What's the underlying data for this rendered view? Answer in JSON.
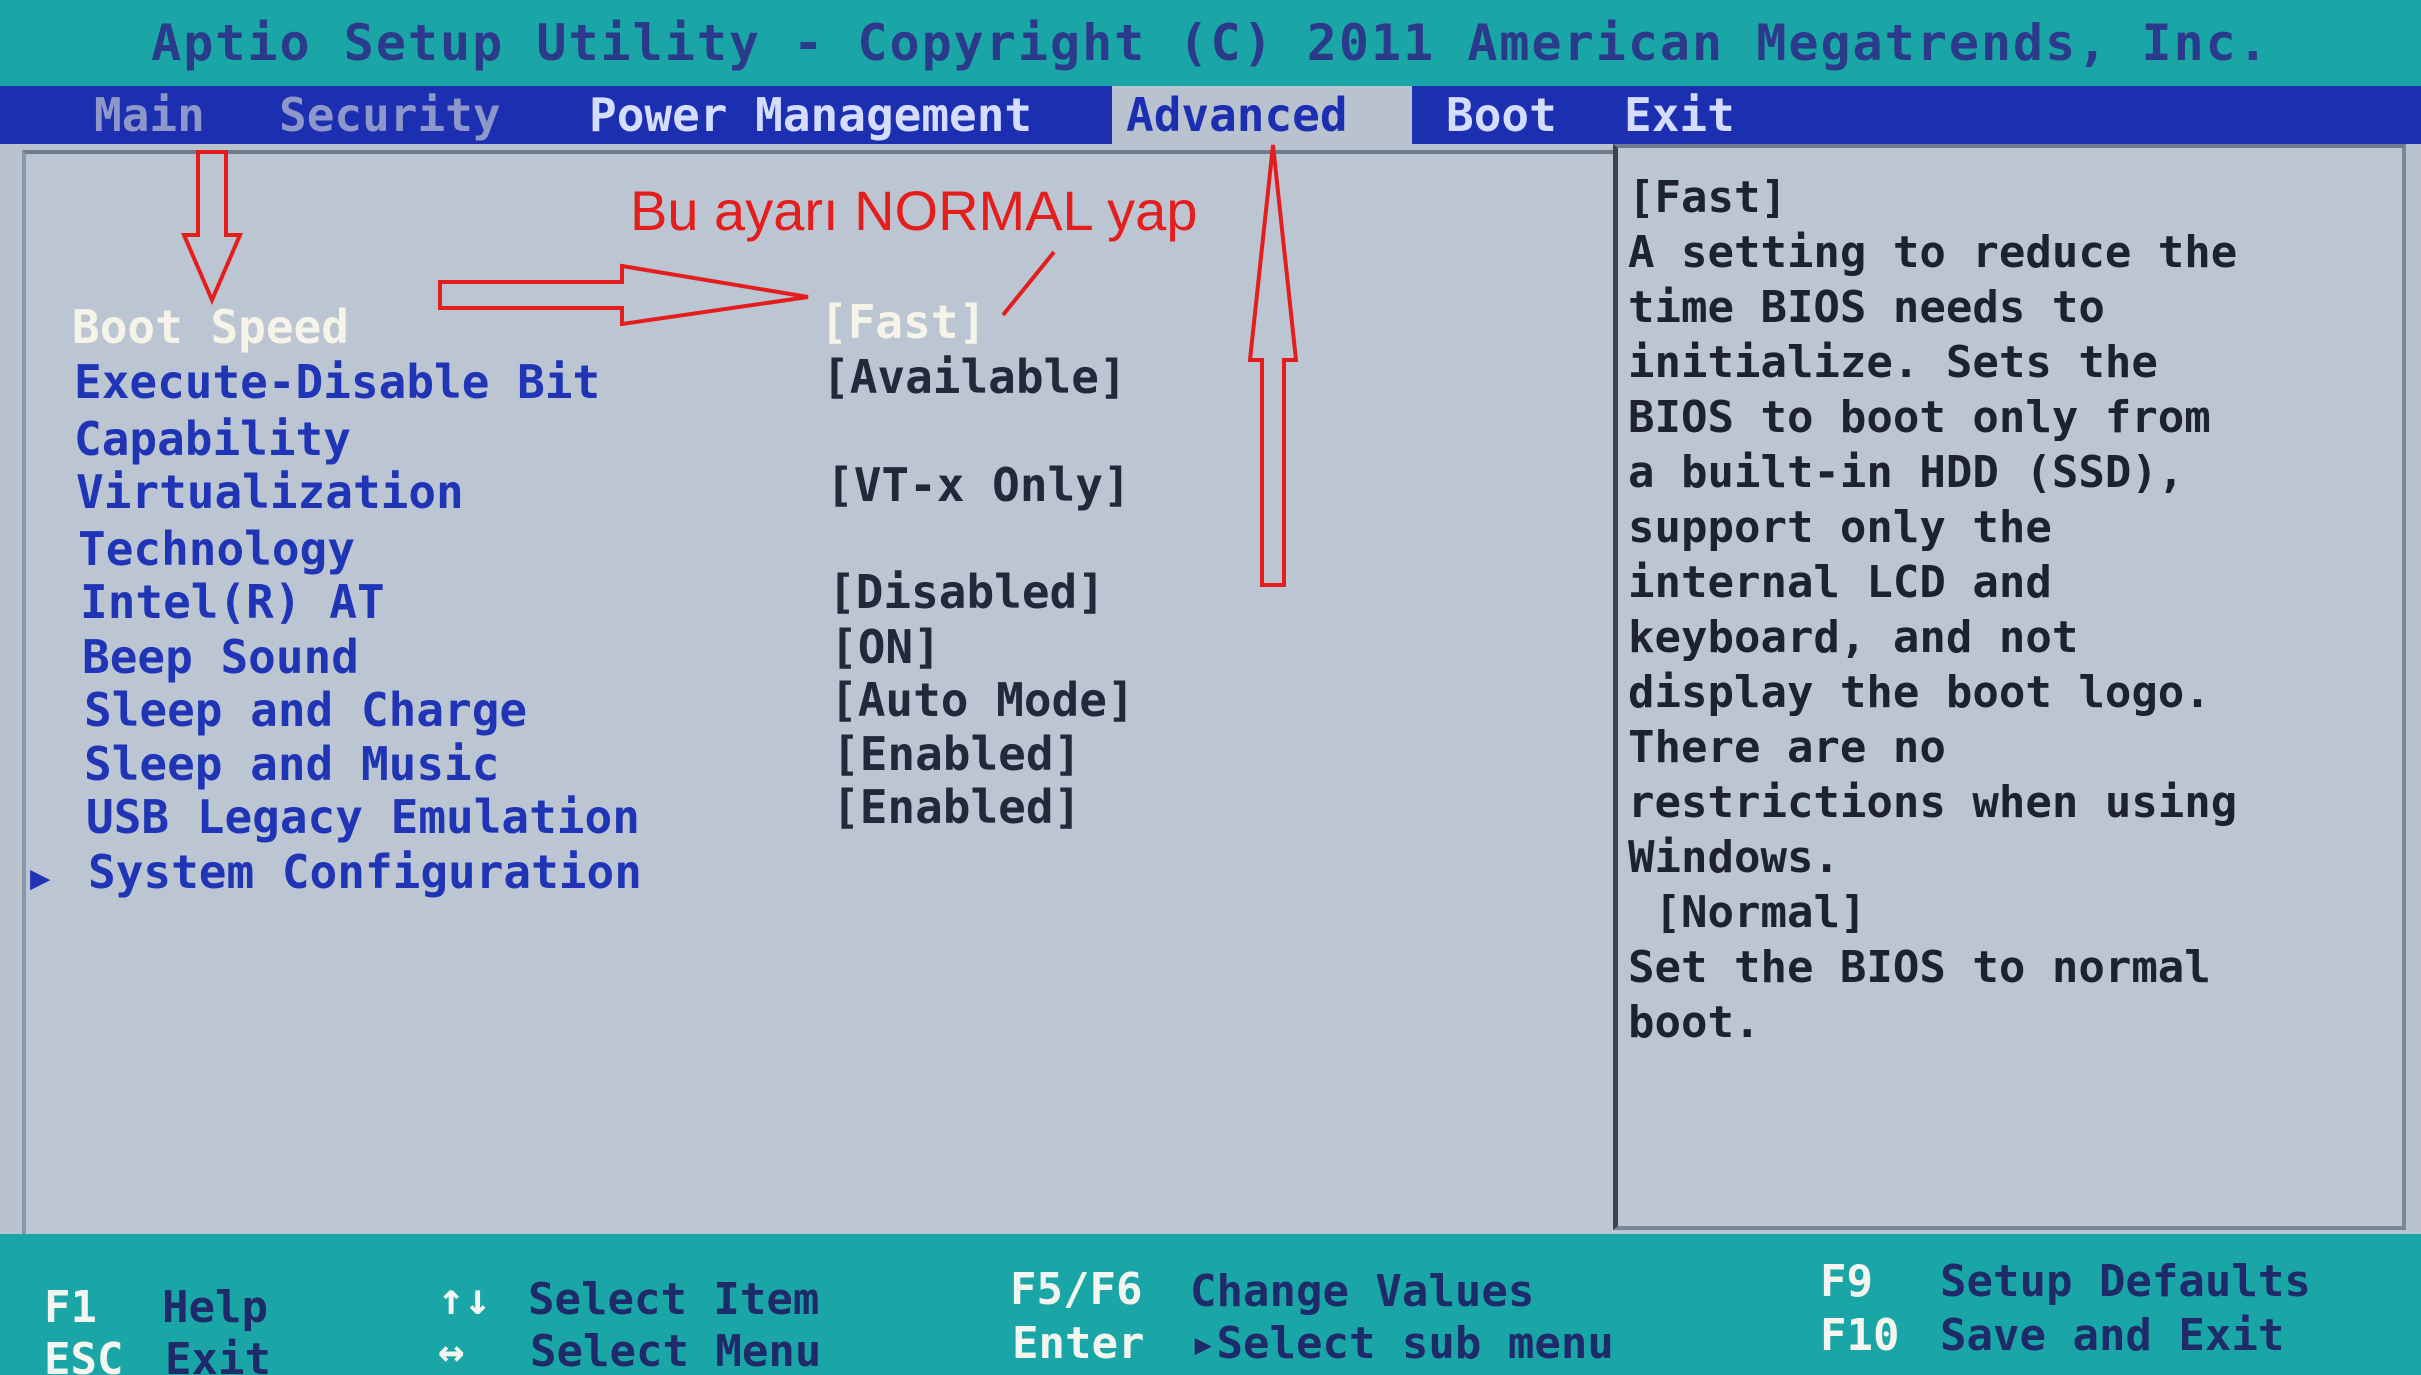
{
  "title": "Aptio Setup Utility - Copyright (C) 2011 American Megatrends, Inc.",
  "menu": {
    "tabs": [
      {
        "label": "Main"
      },
      {
        "label": "Security"
      },
      {
        "label": "Power Management"
      },
      {
        "label": "Advanced",
        "active": true
      },
      {
        "label": "Boot"
      },
      {
        "label": "Exit"
      }
    ]
  },
  "settings": [
    {
      "label": "Boot Speed",
      "value": "[Fast]",
      "selected": true
    },
    {
      "label": "Execute-Disable Bit",
      "value": "[Available]"
    },
    {
      "label": "Capability",
      "value": ""
    },
    {
      "label": "Virtualization",
      "value": "[VT-x Only]"
    },
    {
      "label": "Technology",
      "value": ""
    },
    {
      "label": "Intel(R) AT",
      "value": "[Disabled]"
    },
    {
      "label": "Beep Sound",
      "value": "[ON]"
    },
    {
      "label": "Sleep and Charge",
      "value": "[Auto Mode]"
    },
    {
      "label": "Sleep and Music",
      "value": "[Enabled]"
    },
    {
      "label": "USB Legacy Emulation",
      "value": "[Enabled]"
    },
    {
      "label": "System Configuration",
      "value": "",
      "submenu": true
    }
  ],
  "help": {
    "text": "[Fast]\nA setting to reduce the\ntime BIOS needs to\ninitialize. Sets the\nBIOS to boot only from\na built-in HDD (SSD),\nsupport only the\ninternal LCD and\nkeyboard, and not\ndisplay the boot logo.\nThere are no\nrestrictions when using\nWindows.\n [Normal]\nSet the BIOS to normal\nboot."
  },
  "footer": {
    "f1_key": "F1",
    "f1_desc": "Help",
    "esc_key": "ESC",
    "esc_desc": "Exit",
    "item_key": "↑↓",
    "item_desc": "Select Item",
    "menu_key": "↔",
    "menu_desc": "Select Menu",
    "f5f6_key": "F5/F6",
    "f5f6_desc": "Change Values",
    "enter_key": "Enter",
    "enter_desc": "▸Select sub menu",
    "f9_key": "F9",
    "f9_desc": "Setup Defaults",
    "f10_key": "F10",
    "f10_desc": "Save and Exit"
  },
  "annotation": {
    "text": "Bu ayarı NORMAL yap",
    "color": "#e41d1d"
  },
  "colors": {
    "title_bar": "#1aa6a6",
    "menu_bar": "#1c2fb0",
    "panel": "#bcc6d2",
    "label_blue": "#1f35b5",
    "selected_text": "#f6f4e8"
  }
}
